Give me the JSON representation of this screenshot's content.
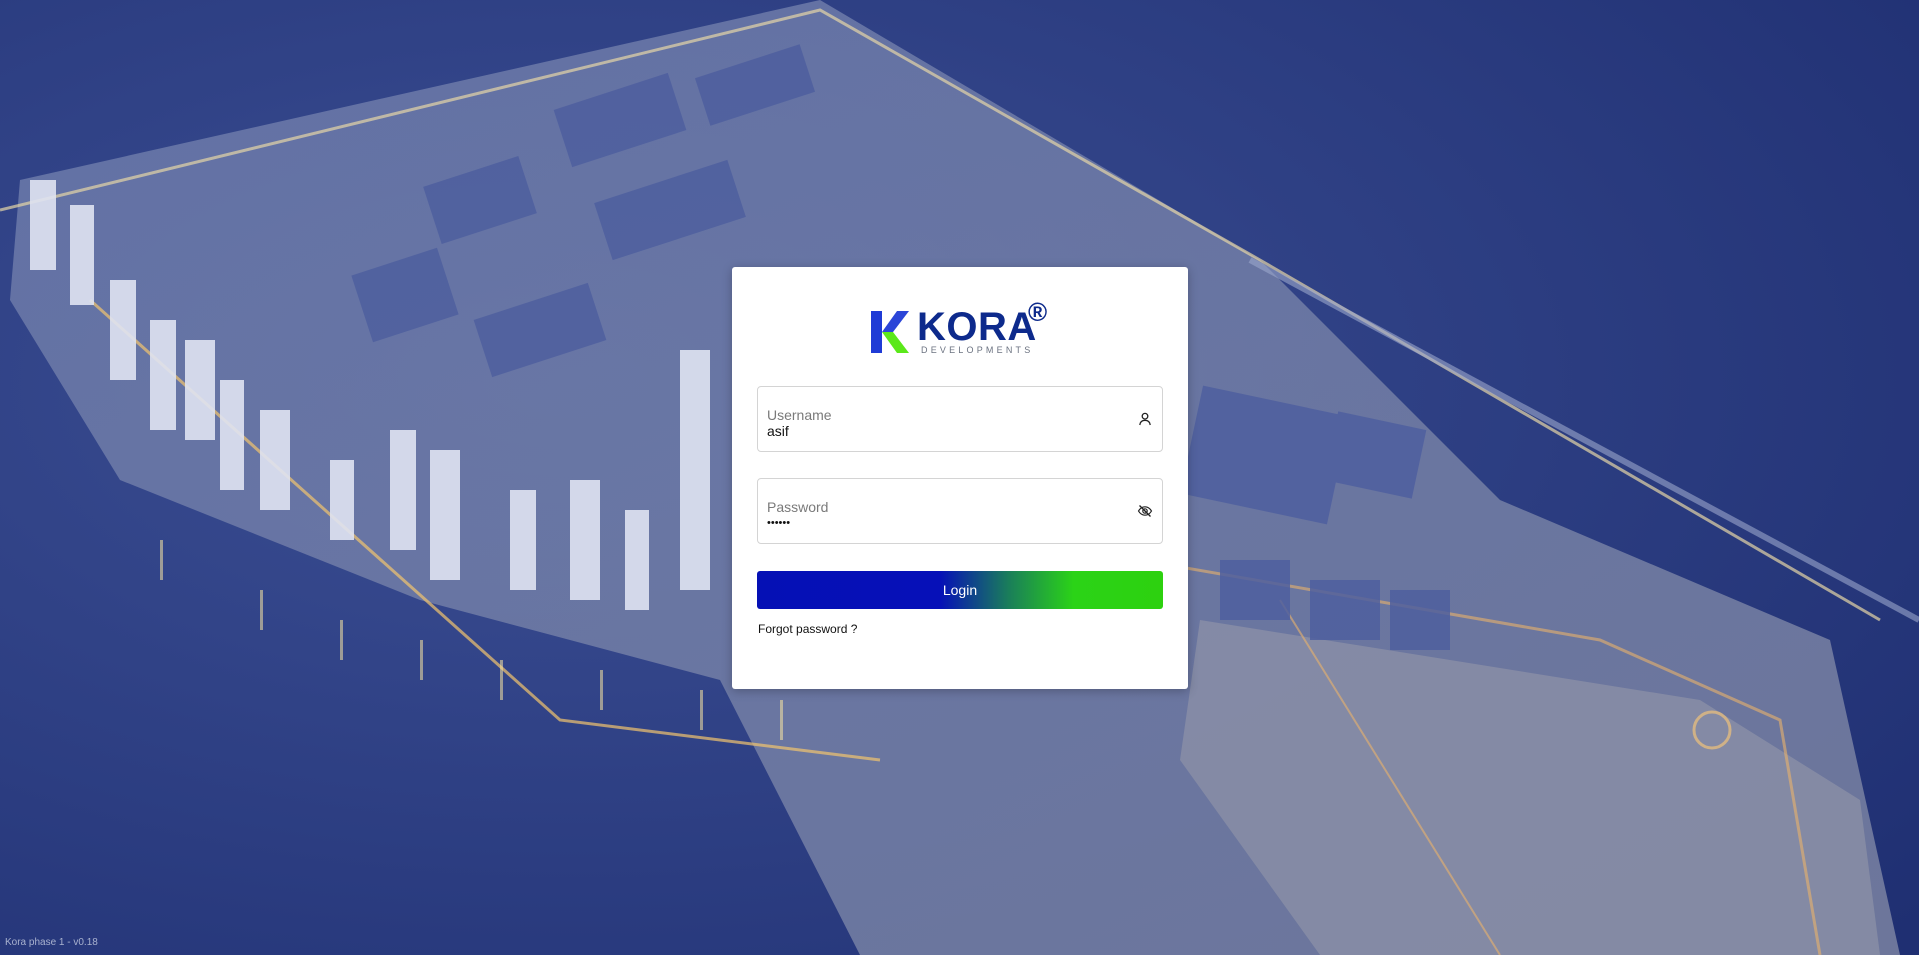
{
  "login": {
    "brand_name": "KORA",
    "brand_registered": "®",
    "brand_subtitle": "DEVELOPMENTS",
    "username_label": "Username",
    "username_value": "asif",
    "password_label": "Password",
    "password_value": "••••••",
    "login_label": "Login",
    "forgot_label": "Forgot password ?"
  },
  "footer": {
    "version": "Kora phase 1 - v0.18"
  },
  "icons": {
    "username": "user-icon",
    "password": "eye-off-icon"
  },
  "colors": {
    "brand_blue": "#0d2a8c",
    "brand_green": "#2dd10f",
    "button_start": "#0510b5",
    "button_end": "#2dd10f"
  }
}
